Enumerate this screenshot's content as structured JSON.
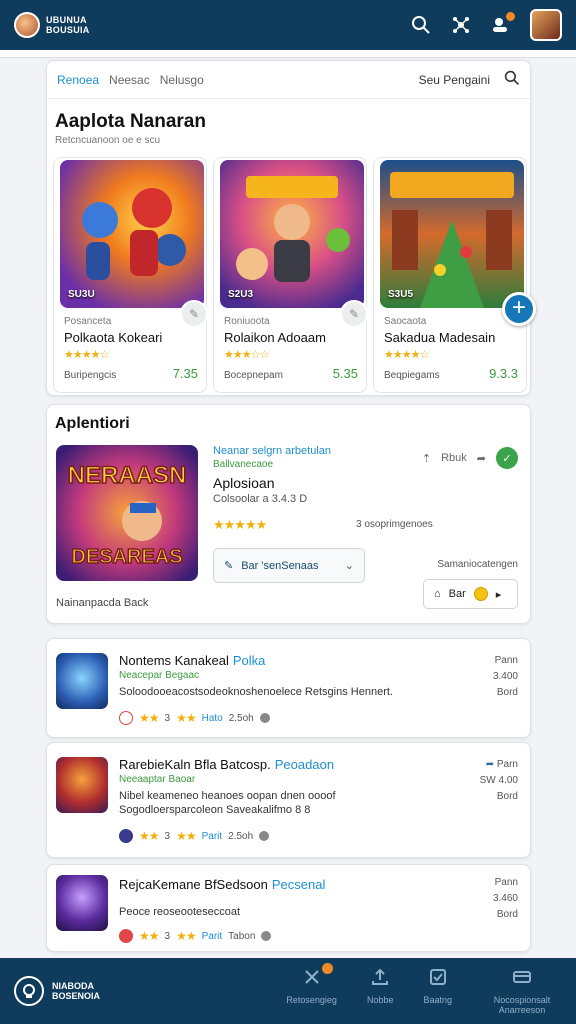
{
  "topbar": {
    "logo_text_1": "UBUNUA",
    "logo_text_2": "BOUSUIA",
    "icons": [
      "search-icon",
      "network-icon",
      "chat-icon"
    ],
    "accent": "#0f3b5c"
  },
  "main": {
    "tabs": [
      {
        "label": "Renoea",
        "active": true
      },
      {
        "label": "Neesac",
        "active": false
      },
      {
        "label": "Nelusgo",
        "active": false
      }
    ],
    "search_label": "Seu Pengaini",
    "title": "Aaplota Nanaran",
    "subtitle": "Retcncuanoon oe e scu",
    "games": [
      {
        "art_label": "SU3U",
        "category": "Posanceta",
        "name": "Polkaota Kokeari",
        "stars": "★★★★☆",
        "meta": "Buripengcis",
        "price": "7.35"
      },
      {
        "art_label": "S2U3",
        "category": "Roniuoota",
        "name": "Rolaikon Adoaam",
        "stars": "★★★☆☆",
        "meta": "Bocepnepam",
        "price": "5.35"
      },
      {
        "art_label": "S3U5",
        "category": "Saocaota",
        "name": "Sakadua Madesain",
        "stars": "★★★★☆",
        "meta": "Beqpiegams",
        "price": "9.3.3"
      }
    ]
  },
  "featured": {
    "section_title": "Aplentiori",
    "art_text_top": "NERAASN",
    "art_text_bottom": "DESAREAS",
    "label": "Neanar  selgrn  arbetulan",
    "label2": "Ballvanecaoe",
    "name": "Aplosioan",
    "sub": "Colsoolar a  3.4.3 D",
    "stars": "★★★★★",
    "rating_text": "3 osoprimgenoes",
    "dropdown_label": "Bar 'senSenaas",
    "action_text": "Rbuk",
    "right_text": "Samaniocatengen",
    "button_label": "Bar",
    "footer": "Nainanpacda Back"
  },
  "list": [
    {
      "title": "Nontems Kanakeal",
      "tag": "Polka",
      "sub": "Neacepar  Begaac",
      "desc": "Soloodooeacostsodeoknoshenoelece Retsgins  Hennert.",
      "score": "3",
      "tag2": "Hato",
      "time": "2.5oh",
      "right_top": "Pann",
      "right_mid": "3.400",
      "right_bot": "Bord",
      "badge_color": "#e04646"
    },
    {
      "title": "RarebieKaln Bfla Batcosp.",
      "tag": "Peoadaon",
      "sub": "Neeaaptar Baoar",
      "desc": "Nibel keameneo  heanoes oopan  dnen  oooof Sogodloersparcoleon Saveakalifmo  8 8",
      "score": "3",
      "tag2": "Parit",
      "time": "2.5oh",
      "right_top": "Parn",
      "right_mid": "SW  4.00",
      "right_bot": "Bord",
      "badge_color": "#3a3a8c"
    },
    {
      "title": "RejcaKemane BfSedsoon",
      "tag": "Pecsenal",
      "sub": "",
      "desc": "Peoce reoseooteseccoat",
      "score": "3",
      "tag2": "Parit",
      "time": "Tabon",
      "right_top": "Pann",
      "right_mid": "3.460",
      "right_bot": "Bord",
      "badge_color": "#e04646"
    }
  ],
  "bottombar": {
    "logo_text_1": "NIABODA",
    "logo_text_2": "BOSENOIA",
    "nav": [
      {
        "label": "Retosengieg",
        "icon": "tools-icon"
      },
      {
        "label": "Nobbe",
        "icon": "upload-icon"
      },
      {
        "label": "Baatng",
        "icon": "checkbox-icon"
      },
      {
        "label": "Nocospionsalt Anarreeson",
        "icon": "card-icon"
      }
    ]
  }
}
